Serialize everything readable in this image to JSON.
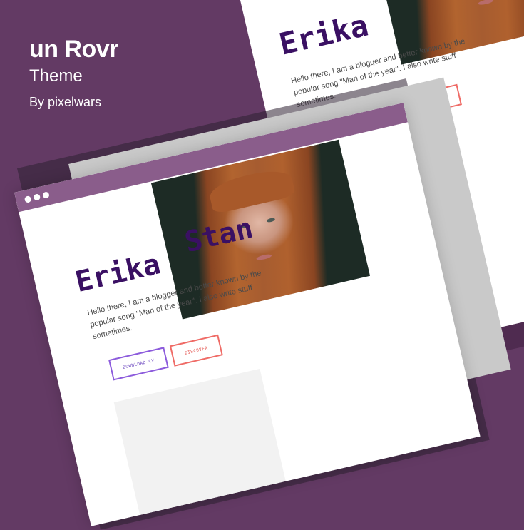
{
  "brand": {
    "title": "un Rovr",
    "subtitle": "Theme",
    "byline": "By pixelwars"
  },
  "colors": {
    "background": "#633a64",
    "titlebar": "#8a5d8b",
    "name": "#3a1063",
    "cv_border": "#8c5bdc",
    "discover_border": "#ef6b66"
  },
  "window": {
    "dots": [
      "window-dot",
      "window-dot",
      "window-dot"
    ]
  },
  "profile": {
    "first_name": "Erika",
    "last_name": "Stan",
    "bio_lines": [
      "Hello there, I am a blogger and better known by the",
      "popular song \"Man of the year\". I also write stuff",
      "sometimes."
    ]
  },
  "buttons": {
    "download_cv": "DOWNLOAD CV",
    "discover": "DISCOVER"
  }
}
